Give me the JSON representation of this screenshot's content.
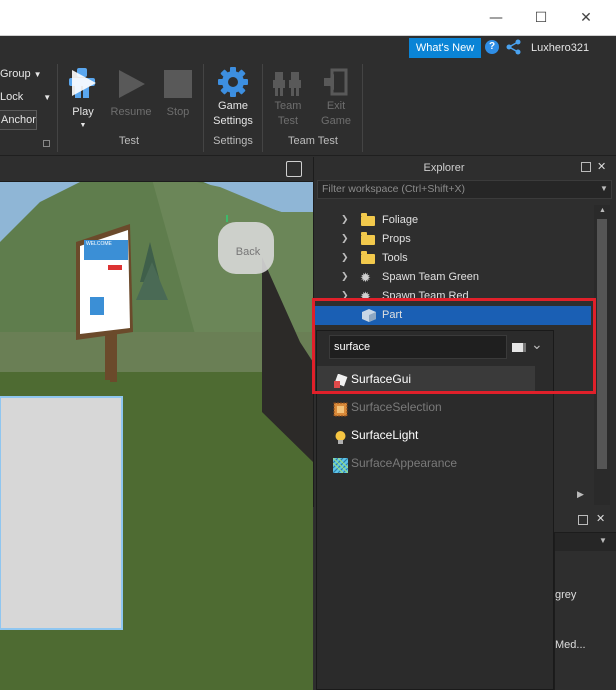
{
  "window": {
    "minimize_icon": "—",
    "maximize_icon": "☐",
    "close_icon": "✕"
  },
  "topbar": {
    "whats_new": "What's New",
    "help_icon": "?",
    "username": "Luxhero321"
  },
  "ribbon": {
    "model_group": {
      "group_label": "Group",
      "lock_label": "Lock",
      "anchor_label": "Anchor"
    },
    "test_group": {
      "play": "Play",
      "resume": "Resume",
      "stop": "Stop",
      "group_label": "Test"
    },
    "settings_group": {
      "game_settings_line1": "Game",
      "game_settings_line2": "Settings",
      "group_label": "Settings"
    },
    "team_test_group": {
      "team_test_line1": "Team",
      "team_test_line2": "Test",
      "exit_game_line1": "Exit",
      "exit_game_line2": "Game",
      "group_label": "Team Test"
    }
  },
  "viewport": {
    "sign_text": "WELCOME",
    "back_label": "Back"
  },
  "explorer": {
    "title": "Explorer",
    "filter_placeholder": "Filter workspace (Ctrl+Shift+X)",
    "items": [
      {
        "label": "Foliage",
        "type": "folder"
      },
      {
        "label": "Props",
        "type": "folder"
      },
      {
        "label": "Tools",
        "type": "folder"
      },
      {
        "label": "Spawn Team Green",
        "type": "spawn"
      },
      {
        "label": "Spawn Team Red",
        "type": "spawn"
      },
      {
        "label": "Part",
        "type": "part",
        "selected": true
      }
    ]
  },
  "insert_popup": {
    "search_value": "surface",
    "results": [
      {
        "label": "SurfaceGui",
        "enabled": true,
        "hovered": true
      },
      {
        "label": "SurfaceSelection",
        "enabled": false
      },
      {
        "label": "SurfaceLight",
        "enabled": true
      },
      {
        "label": "SurfaceAppearance",
        "enabled": false
      }
    ]
  },
  "properties": {
    "value1": "grey",
    "value2": "Med..."
  },
  "colors": {
    "accent": "#0a84d6",
    "selection": "#1a5fb4",
    "highlight": "#e0202a"
  }
}
